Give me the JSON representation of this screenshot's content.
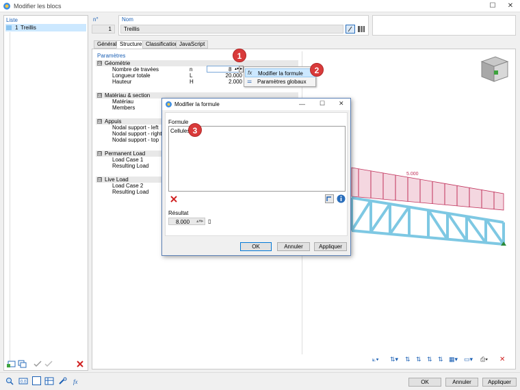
{
  "window": {
    "title": "Modifier les blocs"
  },
  "list": {
    "header": "Liste",
    "items": [
      {
        "number": "1",
        "name": "Treillis"
      }
    ]
  },
  "header": {
    "no_label": "n°",
    "no_value": "1",
    "nom_label": "Nom",
    "nom_value": "Treillis"
  },
  "tabs": [
    {
      "label": "Général"
    },
    {
      "label": "Structure"
    },
    {
      "label": "Classification"
    },
    {
      "label": "JavaScript"
    }
  ],
  "params": {
    "title": "Paramètres",
    "groups": [
      {
        "label": "Géométrie",
        "toggle": "⊟",
        "rows": [
          {
            "label": "Nombre de travées",
            "sym": "n",
            "value": "8"
          },
          {
            "label": "Longueur totale",
            "sym": "L",
            "value": "20.000"
          },
          {
            "label": "Hauteur",
            "sym": "H",
            "value": "2.000"
          }
        ]
      },
      {
        "label": "Matériau & section",
        "toggle": "⊟",
        "rows": [
          {
            "label": "Matériau"
          },
          {
            "label": "Members"
          }
        ]
      },
      {
        "label": "Appuis",
        "toggle": "⊟",
        "rows": [
          {
            "label": "Nodal support - left"
          },
          {
            "label": "Nodal support - right"
          },
          {
            "label": "Nodal support - top"
          }
        ]
      },
      {
        "label": "Permanent Load",
        "toggle": "⊟",
        "rows": [
          {
            "label": "Load Case 1"
          },
          {
            "label": "Resulting Load"
          }
        ]
      },
      {
        "label": "Live Load",
        "toggle": "⊟",
        "rows": [
          {
            "label": "Load Case 2"
          },
          {
            "label": "Resulting Load"
          }
        ]
      }
    ]
  },
  "context_menu": {
    "items": [
      {
        "label": "Modifier la formule"
      },
      {
        "label": "Paramètres globaux"
      }
    ]
  },
  "markers": [
    "1",
    "2",
    "3"
  ],
  "dialog": {
    "title": "Modifier la formule",
    "formula_label": "Formule",
    "formula_text": "Cellules",
    "result_label": "Résultat",
    "result_value": "8.000",
    "ok": "OK",
    "cancel": "Annuler",
    "apply": "Appliquer"
  },
  "view": {
    "load_label": "5.000"
  },
  "footer": {
    "ok": "OK",
    "cancel": "Annuler",
    "apply": "Appliquer"
  },
  "colors": {
    "accent": "#1a5fb4",
    "marker": "#d93a3a",
    "truss": "#7ec8e3",
    "load": "#c0305a"
  }
}
